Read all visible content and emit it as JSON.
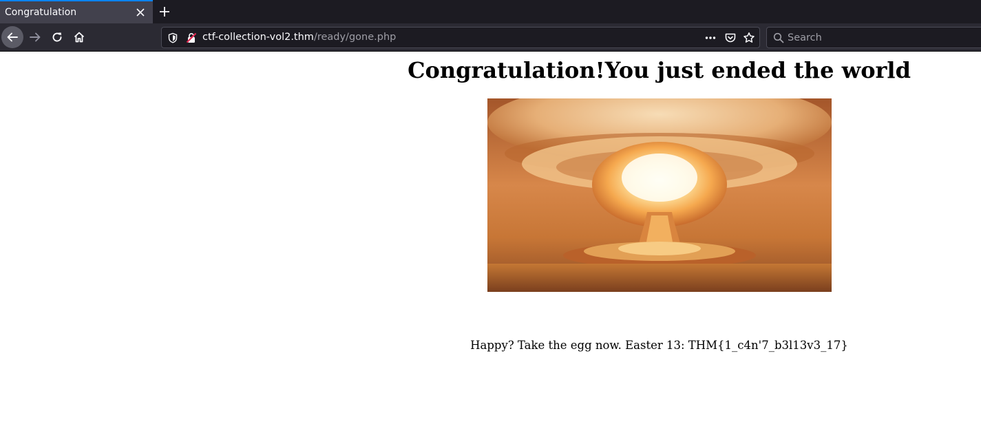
{
  "browser": {
    "tab": {
      "title": "Congratulation"
    },
    "url": {
      "host": "ctf-collection-vol2.thm",
      "path": "/ready/gone.php"
    },
    "search": {
      "placeholder": "Search"
    },
    "icons": [
      "close-icon",
      "plus-icon",
      "back-arrow-icon",
      "forward-arrow-icon",
      "reload-icon",
      "home-icon",
      "shield-icon",
      "insecure-lock-icon",
      "more-icon",
      "pocket-icon",
      "star-icon",
      "search-icon"
    ]
  },
  "page": {
    "heading": "Congratulation!You just ended the world",
    "egg_text": "Happy? Take the egg now. Easter 13: THM{1_c4n'7_b3l13v3_17}"
  },
  "colors": {
    "tabstrip": "#1c1b22",
    "active_tab": "#42414d",
    "tab_accent": "#0a84ff",
    "navbar": "#2b2a33",
    "text_light": "#fbfbfe",
    "text_dim": "#9e9ea6"
  }
}
